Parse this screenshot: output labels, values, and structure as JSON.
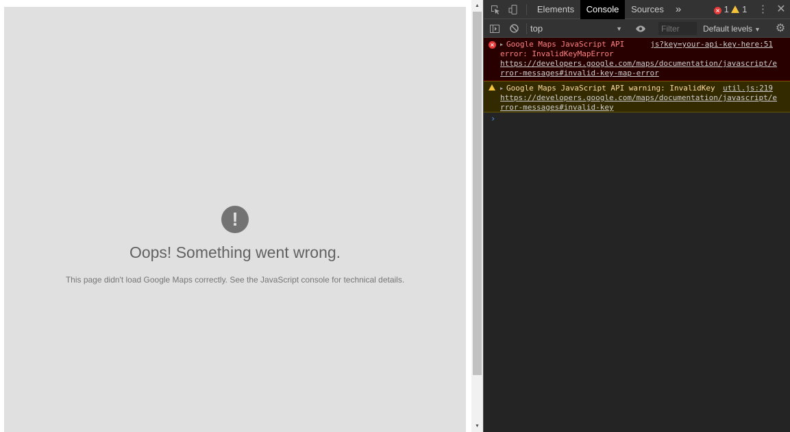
{
  "map_error": {
    "icon_glyph": "!",
    "title": "Oops! Something went wrong.",
    "message": "This page didn't load Google Maps correctly. See the JavaScript console for technical details."
  },
  "devtools": {
    "tabs": [
      {
        "label": "Elements"
      },
      {
        "label": "Console"
      },
      {
        "label": "Sources"
      }
    ],
    "more_tabs_glyph": "»",
    "error_count": "1",
    "warning_count": "1",
    "context": "top",
    "filter_placeholder": "Filter",
    "levels_label": "Default levels",
    "messages": [
      {
        "level": "error",
        "text_line1": "Google Maps JavaScript API",
        "text_line2": "error: InvalidKeyMapError",
        "source": "js?key=your-api-key-here:51",
        "link": "https://developers.google.com/maps/documentation/javascript/error-messages#invalid-key-map-error"
      },
      {
        "level": "warning",
        "text_line1": "Google Maps JavaScript API warning: InvalidKey",
        "source": "util.js:219",
        "link": "https://developers.google.com/maps/documentation/javascript/error-messages#invalid-key"
      }
    ],
    "prompt_glyph": "›"
  },
  "colors": {
    "map_bg": "#e0e0e0",
    "error_bg": "#290000",
    "warning_bg": "#332a00",
    "active_tab_bg": "#000000"
  }
}
